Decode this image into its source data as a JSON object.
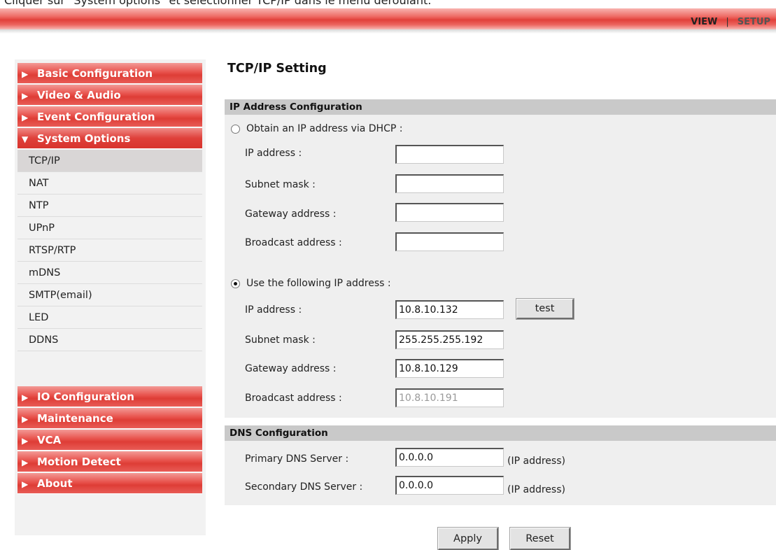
{
  "caption": "Cliquer sur \"System options\" et sélectionner TCP/IP dans le menu déroulant.",
  "topnav": {
    "view": "VIEW",
    "separator": "|",
    "setup": "SETUP"
  },
  "sidebar": {
    "sections_top": [
      {
        "label": "Basic Configuration",
        "arrow": "▶",
        "expanded": false
      },
      {
        "label": "Video & Audio",
        "arrow": "▶",
        "expanded": false
      },
      {
        "label": "Event Configuration",
        "arrow": "▶",
        "expanded": false
      },
      {
        "label": "System Options",
        "arrow": "▼",
        "expanded": true
      }
    ],
    "subitems": [
      "TCP/IP",
      "NAT",
      "NTP",
      "UPnP",
      "RTSP/RTP",
      "mDNS",
      "SMTP(email)",
      "LED",
      "DDNS"
    ],
    "active_subitem": "TCP/IP",
    "sections_bottom": [
      {
        "label": "IO Configuration",
        "arrow": "▶"
      },
      {
        "label": "Maintenance",
        "arrow": "▶"
      },
      {
        "label": "VCA",
        "arrow": "▶"
      },
      {
        "label": "Motion Detect",
        "arrow": "▶"
      },
      {
        "label": "About",
        "arrow": "▶"
      }
    ]
  },
  "main": {
    "title": "TCP/IP Setting",
    "ip_section": {
      "header": "IP Address Configuration",
      "dhcp": {
        "label": "Obtain an IP address via DHCP :",
        "selected": false,
        "fields": [
          {
            "label": "IP address :",
            "value": ""
          },
          {
            "label": "Subnet mask :",
            "value": ""
          },
          {
            "label": "Gateway address :",
            "value": ""
          },
          {
            "label": "Broadcast address :",
            "value": ""
          }
        ]
      },
      "static": {
        "label": "Use the following IP address :",
        "selected": true,
        "fields": [
          {
            "label": "IP address :",
            "value": "10.8.10.132"
          },
          {
            "label": "Subnet mask :",
            "value": "255.255.255.192"
          },
          {
            "label": "Gateway address :",
            "value": "10.8.10.129"
          },
          {
            "label": "Broadcast address :",
            "value": "10.8.10.191",
            "disabled": true
          }
        ],
        "test_button": "test"
      }
    },
    "dns_section": {
      "header": "DNS Configuration",
      "fields": [
        {
          "label": "Primary DNS Server :",
          "value": "0.0.0.0",
          "unit": "(IP address)"
        },
        {
          "label": "Secondary DNS Server :",
          "value": "0.0.0.0",
          "unit": "(IP address)"
        }
      ]
    },
    "buttons": {
      "apply": "Apply",
      "reset": "Reset"
    }
  },
  "colors": {
    "menu_red": "#e2463f",
    "header_gradient_mid": "#e2403a",
    "section_header_gray": "#c9c9c9",
    "panel_gray": "#efefef",
    "active_sub_bg": "#d9d6d6"
  }
}
